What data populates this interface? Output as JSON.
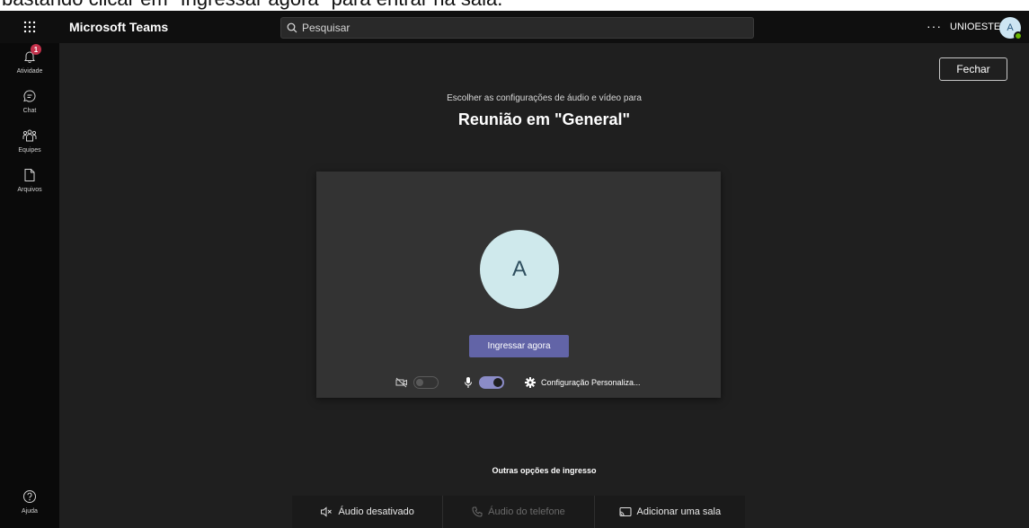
{
  "caption": "bastando clicar em \"Ingressar agora\" para entrar na sala.",
  "header": {
    "app_title": "Microsoft Teams",
    "search_placeholder": "Pesquisar",
    "more_label": "···",
    "org_name": "UNIOESTE",
    "avatar_initial": "A"
  },
  "rail": {
    "items": [
      {
        "label": "Atividade",
        "icon": "bell-icon",
        "badge": "1"
      },
      {
        "label": "Chat",
        "icon": "chat-icon"
      },
      {
        "label": "Equipes",
        "icon": "teams-icon"
      },
      {
        "label": "Arquivos",
        "icon": "file-icon"
      }
    ],
    "help_label": "Ajuda"
  },
  "prejoin": {
    "close_label": "Fechar",
    "subtitle": "Escolher as configurações de áudio e vídeo para",
    "meeting_title": "Reunião em \"General\"",
    "avatar_initial": "A",
    "join_label": "Ingressar agora",
    "camera_on": false,
    "mic_on": true,
    "settings_label": "Configuração Personaliza..."
  },
  "other_options": {
    "title": "Outras opções de ingresso",
    "items": [
      {
        "label": "Áudio desativado",
        "icon": "speaker-off-icon",
        "disabled": false
      },
      {
        "label": "Áudio do telefone",
        "icon": "phone-icon",
        "disabled": true
      },
      {
        "label": "Adicionar uma sala",
        "icon": "cast-icon",
        "disabled": false
      }
    ]
  },
  "colors": {
    "accent": "#6264a7",
    "badge": "#c4314b",
    "presence": "#6bb700",
    "background": "#1f1f1f"
  }
}
